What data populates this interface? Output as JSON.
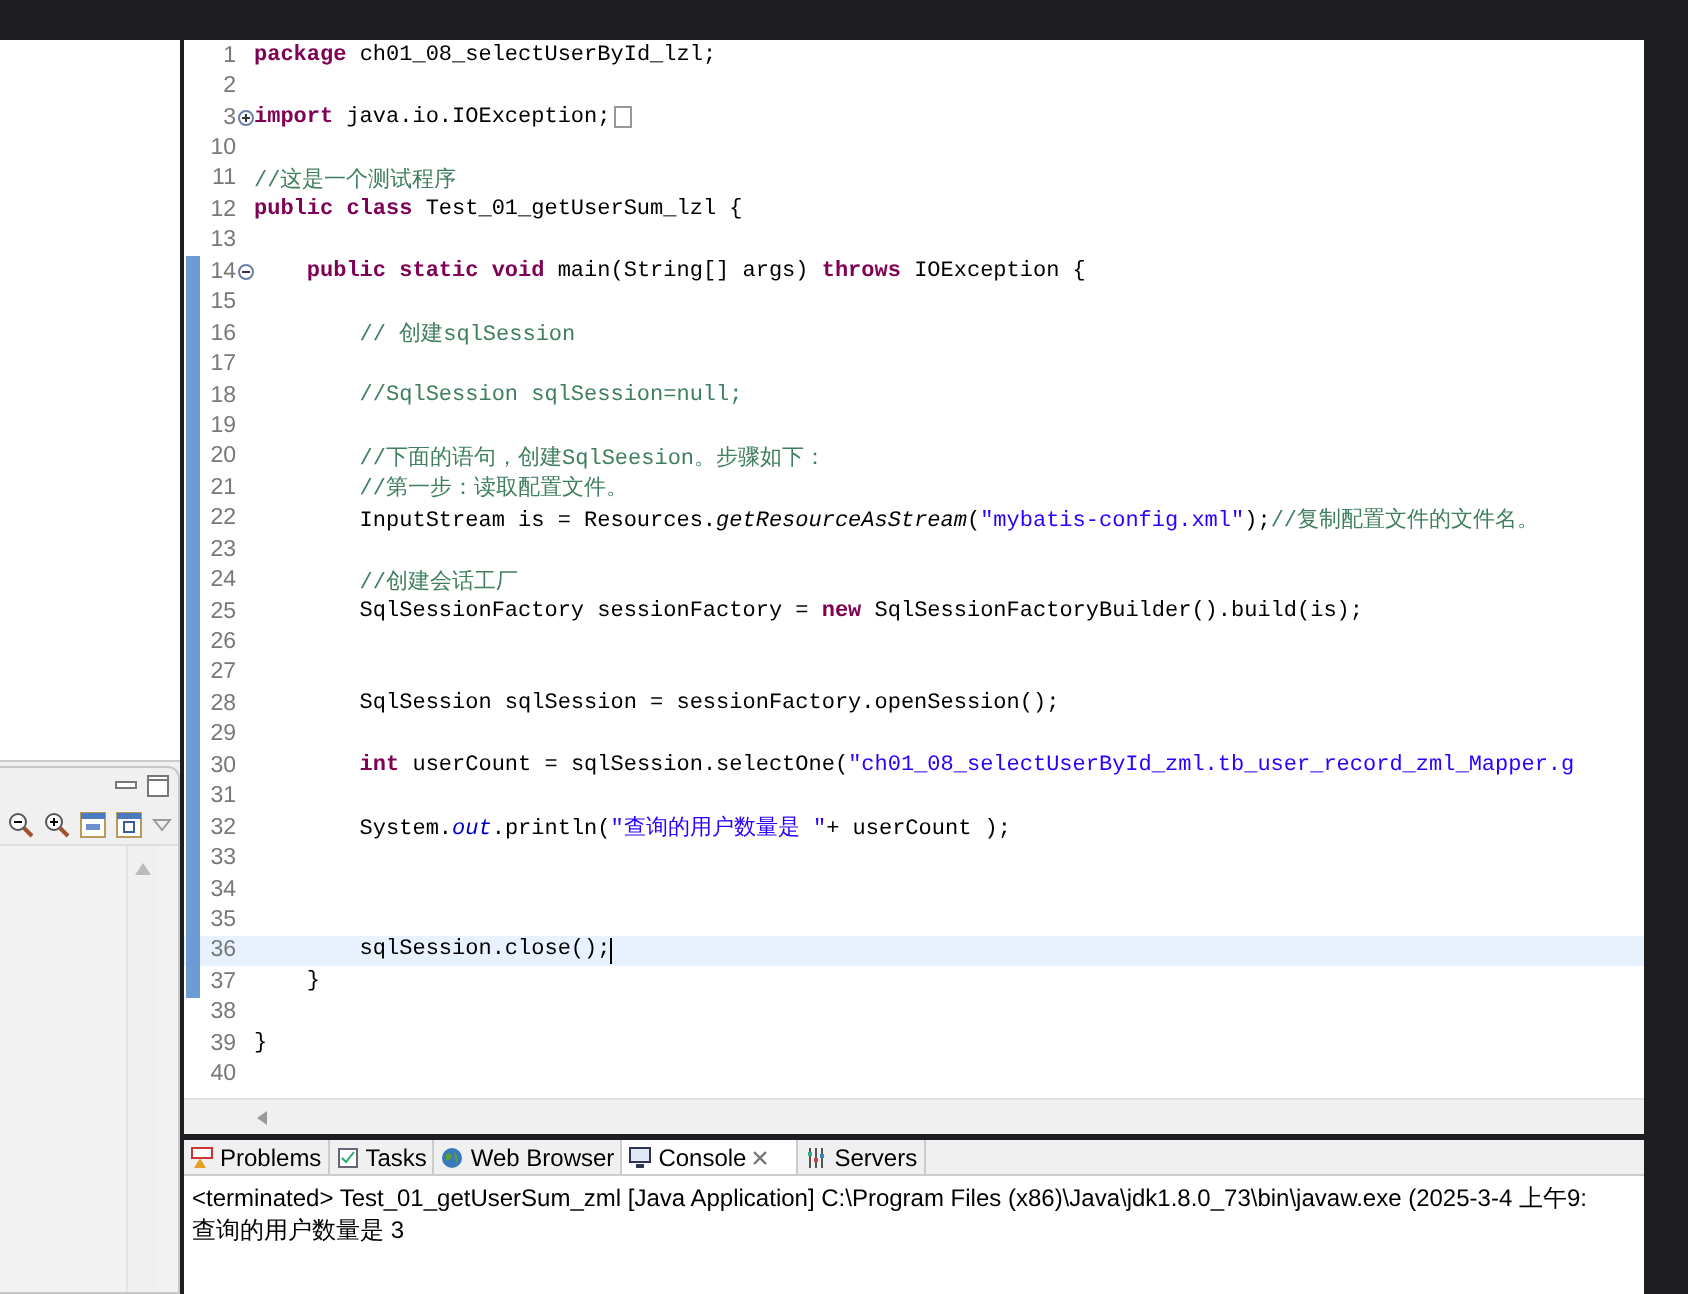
{
  "editor": {
    "lines": [
      {
        "number": "1",
        "kind": "normal",
        "marked": false,
        "current": false,
        "tokens": [
          {
            "kind": "keyword",
            "text": "package"
          },
          {
            "kind": "plain",
            "text": " ch01_08_selectUserById_lzl;"
          }
        ]
      },
      {
        "number": "2",
        "kind": "normal",
        "marked": false,
        "current": false
      },
      {
        "number": "3",
        "kind": "collapsed",
        "marked": false,
        "current": false,
        "tokens": [
          {
            "kind": "keyword",
            "text": "import"
          },
          {
            "kind": "plain",
            "text": " java.io.IOException;"
          }
        ]
      },
      {
        "number": "10",
        "kind": "normal",
        "marked": false,
        "current": false
      },
      {
        "number": "11",
        "kind": "normal",
        "marked": false,
        "current": false,
        "tokens": [
          {
            "kind": "comment",
            "text": "//这是一个测试程序"
          }
        ]
      },
      {
        "number": "12",
        "kind": "normal",
        "marked": false,
        "current": false,
        "tokens": [
          {
            "kind": "keyword",
            "text": "public class"
          },
          {
            "kind": "plain",
            "text": " Test_01_getUserSum_lzl {"
          }
        ]
      },
      {
        "number": "13",
        "kind": "normal",
        "marked": false,
        "current": false
      },
      {
        "number": "14",
        "kind": "expanded",
        "marked": true,
        "current": false,
        "tokens": [
          {
            "kind": "keyword",
            "text": "    public static void"
          },
          {
            "kind": "plain",
            "text": " main(String[] args) "
          },
          {
            "kind": "keyword",
            "text": "throws"
          },
          {
            "kind": "plain",
            "text": " IOException {"
          }
        ]
      },
      {
        "number": "15",
        "kind": "normal",
        "marked": true,
        "current": false
      },
      {
        "number": "16",
        "kind": "normal",
        "marked": true,
        "current": false,
        "tokens": [
          {
            "kind": "comment",
            "text": "        // 创建sqlSession"
          }
        ]
      },
      {
        "number": "17",
        "kind": "normal",
        "marked": true,
        "current": false
      },
      {
        "number": "18",
        "kind": "normal",
        "marked": true,
        "current": false,
        "tokens": [
          {
            "kind": "comment",
            "text": "        //SqlSession sqlSession=null;"
          }
        ]
      },
      {
        "number": "19",
        "kind": "normal",
        "marked": true,
        "current": false
      },
      {
        "number": "20",
        "kind": "normal",
        "marked": true,
        "current": false,
        "tokens": [
          {
            "kind": "comment",
            "text": "        //下面的语句，创建SqlSeesion。步骤如下："
          }
        ]
      },
      {
        "number": "21",
        "kind": "normal",
        "marked": true,
        "current": false,
        "tokens": [
          {
            "kind": "comment",
            "text": "        //第一步：读取配置文件。"
          }
        ]
      },
      {
        "number": "22",
        "kind": "normal",
        "marked": true,
        "current": false,
        "tokens": [
          {
            "kind": "plain",
            "text": "        InputStream is = Resources."
          },
          {
            "kind": "static",
            "text": "getResourceAsStream"
          },
          {
            "kind": "plain",
            "text": "("
          },
          {
            "kind": "string",
            "text": "\"mybatis-config.xml\""
          },
          {
            "kind": "plain",
            "text": ");"
          },
          {
            "kind": "comment",
            "text": "//复制配置文件的文件名。"
          }
        ]
      },
      {
        "number": "23",
        "kind": "normal",
        "marked": true,
        "current": false
      },
      {
        "number": "24",
        "kind": "normal",
        "marked": true,
        "current": false,
        "tokens": [
          {
            "kind": "comment",
            "text": "        //创建会话工厂"
          }
        ]
      },
      {
        "number": "25",
        "kind": "normal",
        "marked": true,
        "current": false,
        "tokens": [
          {
            "kind": "plain",
            "text": "        SqlSessionFactory sessionFactory = "
          },
          {
            "kind": "keyword",
            "text": "new"
          },
          {
            "kind": "plain",
            "text": " SqlSessionFactoryBuilder().build(is);"
          }
        ]
      },
      {
        "number": "26",
        "kind": "normal",
        "marked": true,
        "current": false
      },
      {
        "number": "27",
        "kind": "normal",
        "marked": true,
        "current": false
      },
      {
        "number": "28",
        "kind": "normal",
        "marked": true,
        "current": false,
        "tokens": [
          {
            "kind": "plain",
            "text": "        SqlSession sqlSession = sessionFactory.openSession();"
          }
        ]
      },
      {
        "number": "29",
        "kind": "normal",
        "marked": true,
        "current": false
      },
      {
        "number": "30",
        "kind": "normal",
        "marked": true,
        "current": false,
        "tokens": [
          {
            "kind": "keyword",
            "text": "        int"
          },
          {
            "kind": "plain",
            "text": " userCount = sqlSession.selectOne("
          },
          {
            "kind": "string",
            "text": "\"ch01_08_selectUserById_zml.tb_user_record_zml_Mapper.g"
          }
        ]
      },
      {
        "number": "31",
        "kind": "normal",
        "marked": true,
        "current": false
      },
      {
        "number": "32",
        "kind": "normal",
        "marked": true,
        "current": false,
        "tokens": [
          {
            "kind": "plain",
            "text": "        System."
          },
          {
            "kind": "field",
            "text": "out"
          },
          {
            "kind": "plain",
            "text": ".println("
          },
          {
            "kind": "string",
            "text": "\"查询的用户数量是 \""
          },
          {
            "kind": "plain",
            "text": "+ userCount );"
          }
        ]
      },
      {
        "number": "33",
        "kind": "normal",
        "marked": true,
        "current": false
      },
      {
        "number": "34",
        "kind": "normal",
        "marked": true,
        "current": false
      },
      {
        "number": "35",
        "kind": "normal",
        "marked": true,
        "current": false
      },
      {
        "number": "36",
        "kind": "normal",
        "marked": true,
        "current": true,
        "tokens": [
          {
            "kind": "plain",
            "text": "        sqlSession.close();"
          }
        ]
      },
      {
        "number": "37",
        "kind": "normal",
        "marked": true,
        "current": false,
        "tokens": [
          {
            "kind": "plain",
            "text": "    }"
          }
        ]
      },
      {
        "number": "38",
        "kind": "normal",
        "marked": false,
        "current": false
      },
      {
        "number": "39",
        "kind": "normal",
        "marked": false,
        "current": false,
        "tokens": [
          {
            "kind": "plain",
            "text": "}"
          }
        ]
      },
      {
        "number": "40",
        "kind": "normal",
        "marked": false,
        "current": false
      }
    ]
  },
  "bottom_panel": {
    "tabs": [
      {
        "label": "Problems",
        "kind": "problems",
        "selected": false
      },
      {
        "label": "Tasks",
        "kind": "tasks",
        "selected": false
      },
      {
        "label": "Web Browser",
        "kind": "browser",
        "selected": false
      },
      {
        "label": "Console",
        "kind": "console",
        "selected": true
      },
      {
        "label": "Servers",
        "kind": "servers",
        "selected": false
      }
    ],
    "console": {
      "status": "<terminated> Test_01_getUserSum_zml [Java Application] C:\\Program Files (x86)\\Java\\jdk1.8.0_73\\bin\\javaw.exe (2025-3-4 上午9:",
      "output": [
        "查询的用户数量是 3"
      ]
    }
  }
}
